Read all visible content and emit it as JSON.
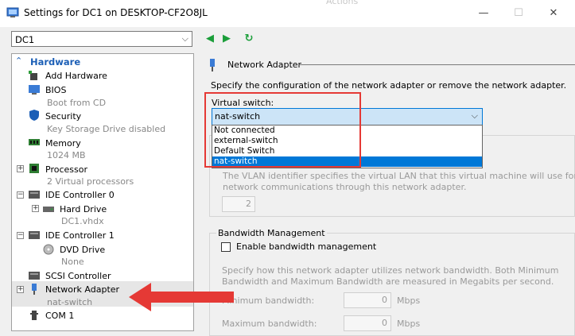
{
  "window": {
    "title": "Settings for DC1 on DESKTOP-CF2O8JL",
    "ghost_text": "Actions",
    "minimize": "—",
    "maximize": "☐",
    "close": "✕"
  },
  "vm_selector": {
    "value": "DC1"
  },
  "nav": {
    "back": "◀",
    "forward": "▶",
    "refresh": "↻"
  },
  "tree": {
    "section": "Hardware",
    "items": [
      {
        "label": "Add Hardware",
        "sub": ""
      },
      {
        "label": "BIOS",
        "sub": "Boot from CD"
      },
      {
        "label": "Security",
        "sub": "Key Storage Drive disabled"
      },
      {
        "label": "Memory",
        "sub": "1024 MB"
      },
      {
        "label": "Processor",
        "sub": "2 Virtual processors"
      },
      {
        "label": "IDE Controller 0",
        "sub": ""
      },
      {
        "label": "Hard Drive",
        "sub": "DC1.vhdx"
      },
      {
        "label": "IDE Controller 1",
        "sub": ""
      },
      {
        "label": "DVD Drive",
        "sub": "None"
      },
      {
        "label": "SCSI Controller",
        "sub": ""
      },
      {
        "label": "Network Adapter",
        "sub": "nat-switch"
      },
      {
        "label": "COM 1",
        "sub": ""
      }
    ],
    "expander": "+"
  },
  "network_adapter": {
    "title": "Network Adapter",
    "description": "Specify the configuration of the network adapter or remove the network adapter.",
    "virtual_switch_label": "Virtual switch:",
    "virtual_switch_value": "nat-switch",
    "options": [
      "Not connected",
      "external-switch",
      "Default Switch",
      "nat-switch"
    ],
    "selected_option_index": 3
  },
  "vlan": {
    "description_line1": "The VLAN identifier specifies the virtual LAN that this virtual machine will use for all",
    "description_line2": "network communications through this network adapter.",
    "value": "2"
  },
  "bandwidth": {
    "title": "Bandwidth Management",
    "enable_label": "Enable bandwidth management",
    "description_line1": "Specify how this network adapter utilizes network bandwidth. Both Minimum",
    "description_line2": "Bandwidth and Maximum Bandwidth are measured in Megabits per second.",
    "min_label": "Minimum bandwidth:",
    "min_value": "0",
    "max_label": "Maximum bandwidth:",
    "max_value": "0",
    "unit": "Mbps"
  },
  "colors": {
    "highlight_red": "#e53935",
    "selection_blue": "#0078d7",
    "tree_blue": "#1c5fb6",
    "nav_green": "#1b9e3a"
  }
}
